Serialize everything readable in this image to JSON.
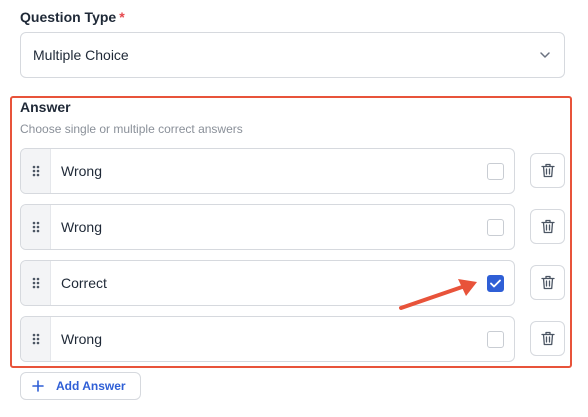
{
  "question_type": {
    "label": "Question Type",
    "required_mark": "*",
    "selected": "Multiple Choice"
  },
  "answer": {
    "title": "Answer",
    "subtitle": "Choose single or multiple correct answers",
    "options": [
      {
        "text": "Wrong",
        "checked": false
      },
      {
        "text": "Wrong",
        "checked": false
      },
      {
        "text": "Correct",
        "checked": true
      },
      {
        "text": "Wrong",
        "checked": false
      }
    ],
    "add_label": "Add Answer"
  },
  "colors": {
    "accent": "#2f5fd6",
    "highlight": "#e8533a",
    "required": "#e5484d"
  },
  "icons": {
    "select_chevron": "chevron-down-icon",
    "drag_handle": "drag-handle-icon",
    "delete": "trash-icon",
    "add": "plus-icon",
    "annotation": "arrow-annotation"
  }
}
